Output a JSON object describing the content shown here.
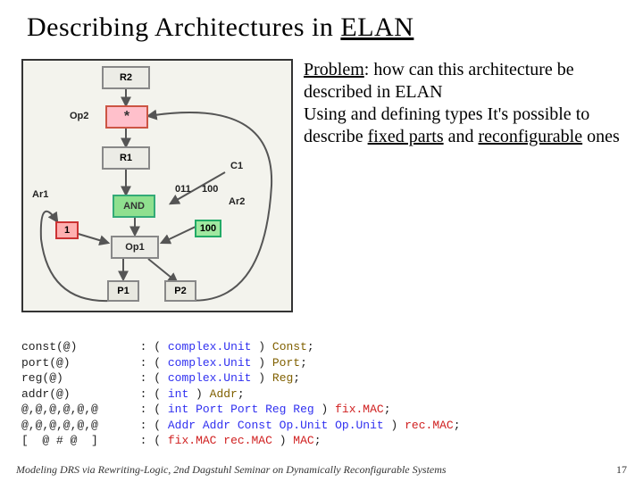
{
  "title": {
    "pre": "Describing Architectures in ",
    "u": "ELAN"
  },
  "diagram": {
    "r2": "R2",
    "op2": "Op2",
    "star": "*",
    "r1": "R1",
    "c1": "C1",
    "ar1": "Ar1",
    "ar2": "Ar2",
    "and": "AND",
    "one": "1",
    "bits011": "011",
    "bits1001": "100",
    "bits1002": "100",
    "op1": "Op1",
    "p1": "P1",
    "p2": "P2"
  },
  "problem": {
    "l1a": "Problem",
    "l1b": ": how can this architecture be described in ELAN",
    "l2a": "Using and defining types It's possible to describe ",
    "l2b": "fixed parts",
    "l2c": " and ",
    "l2d": "reconfigurable",
    "l2e": " ones"
  },
  "code": {
    "r1a": "const(@)",
    "r1b": ": ( ",
    "r1c": "complex.Unit",
    "r1d": " ) ",
    "r1e": "Const",
    "r1f": ";",
    "r2a": "port(@)",
    "r2b": ": ( ",
    "r2c": "complex.Unit",
    "r2d": " ) ",
    "r2e": "Port",
    "r2f": ";",
    "r3a": "reg(@)",
    "r3b": ": ( ",
    "r3c": "complex.Unit",
    "r3d": " ) ",
    "r3e": "Reg",
    "r3f": ";",
    "r4a": "addr(@)",
    "r4b": ": ( ",
    "r4c": "int",
    "r4d": " ) ",
    "r4e": "Addr",
    "r4f": ";",
    "r5a": "@,@,@,@,@,@",
    "r5b": ": ( ",
    "r5c": "int Port Port Reg Reg",
    "r5d": " ) ",
    "r5e": "fix.MAC",
    "r5f": ";",
    "r6a": "@,@,@,@,@,@",
    "r6b": ": ( ",
    "r6c": "Addr Addr Const Op.Unit Op.Unit",
    "r6d": " ) ",
    "r6e": "rec.MAC",
    "r6f": ";",
    "r7a": "[  @ # @  ]",
    "r7b": ": ( ",
    "r7c": "fix.MAC rec.MAC",
    "r7d": " ) ",
    "r7e": "MAC",
    "r7f": ";"
  },
  "footer": {
    "text": "Modeling DRS via Rewriting-Logic, 2nd Dagstuhl Seminar on Dynamically Reconfigurable Systems",
    "page": "17"
  }
}
